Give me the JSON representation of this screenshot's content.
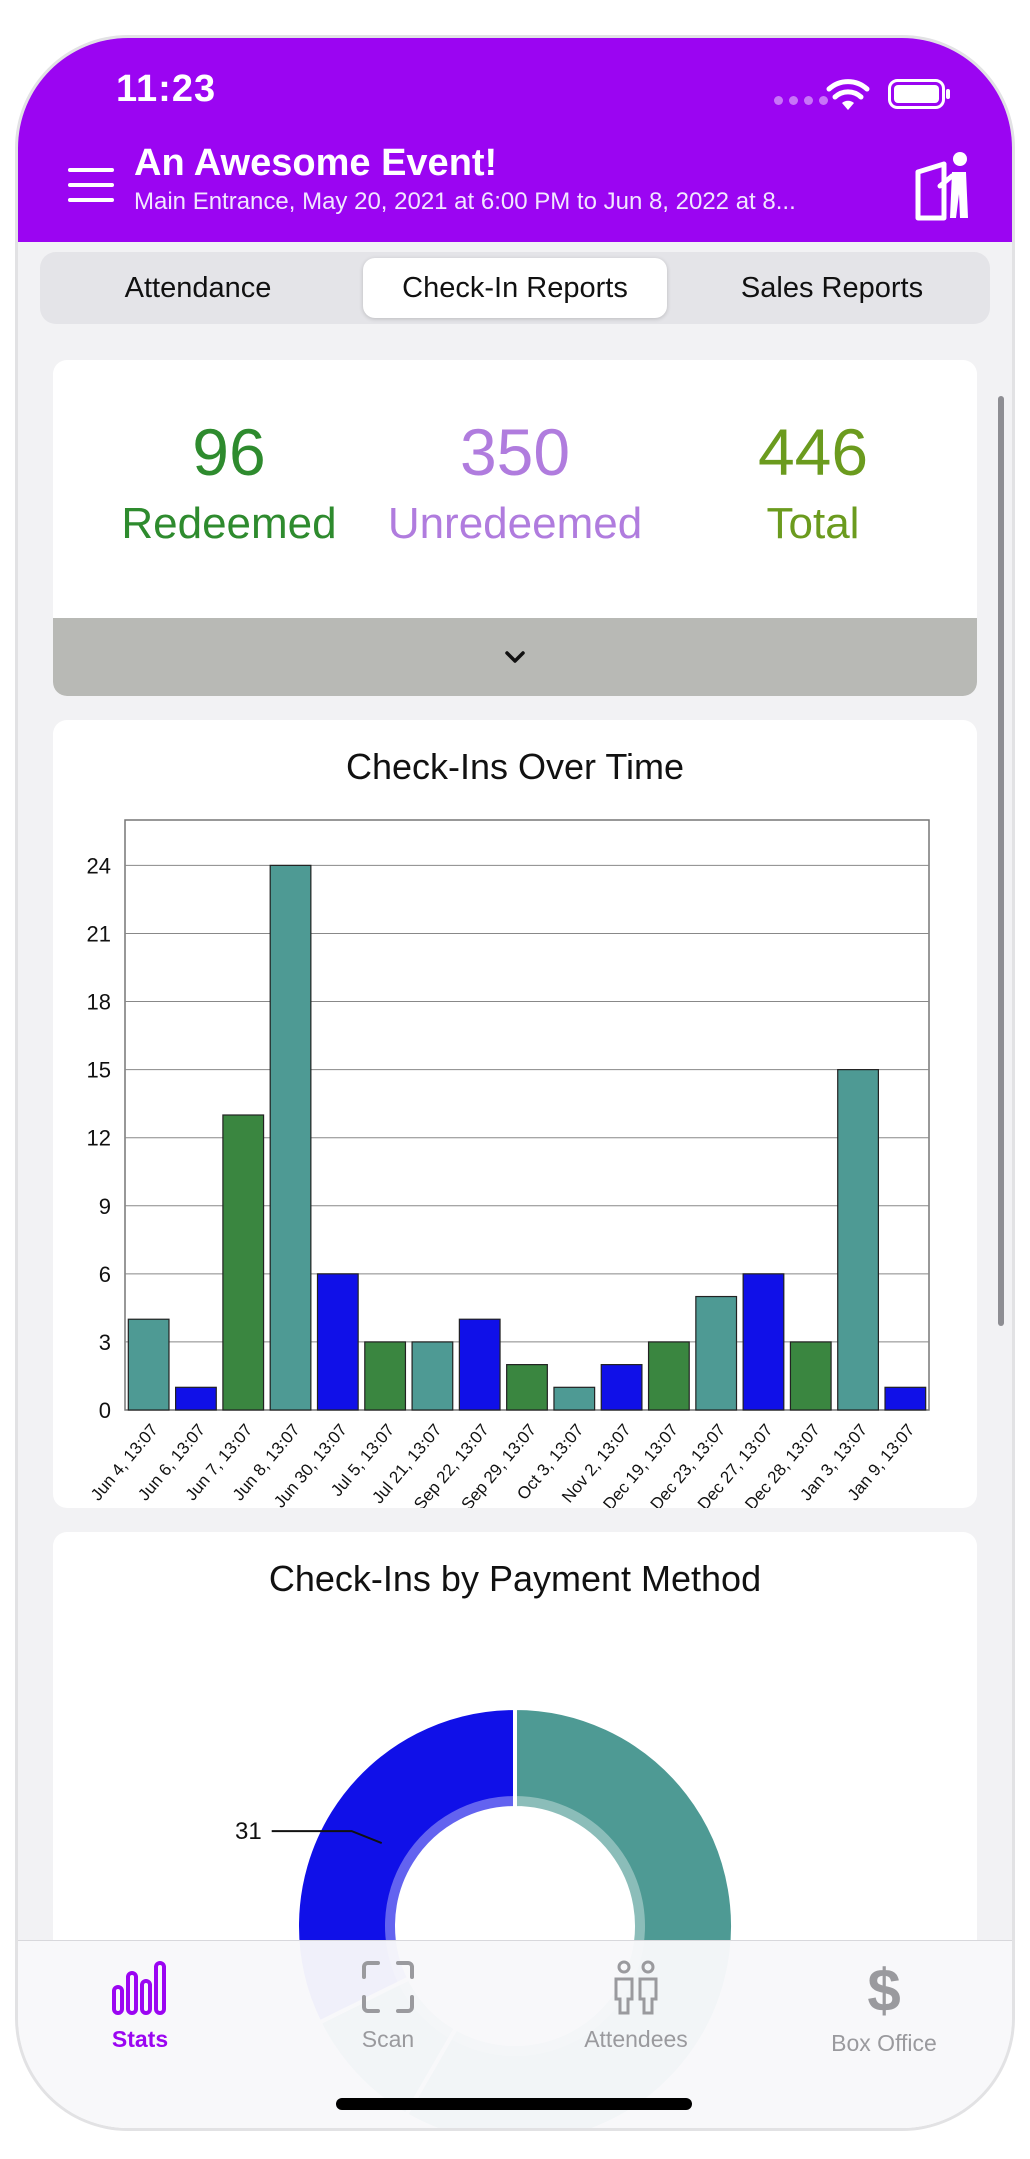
{
  "status_bar": {
    "time": "11:23"
  },
  "header": {
    "title": "An Awesome Event!",
    "subtitle": "Main Entrance, May 20, 2021 at 6:00 PM to Jun  8, 2022 at 8..."
  },
  "tabs": [
    {
      "label": "Attendance",
      "active": false
    },
    {
      "label": "Check-In Reports",
      "active": true
    },
    {
      "label": "Sales Reports",
      "active": false
    }
  ],
  "summary": {
    "redeemed_value": "96",
    "redeemed_label": "Redeemed",
    "redeemed_color": "#2e8b2e",
    "unredeemed_value": "350",
    "unredeemed_label": "Unredeemed",
    "unredeemed_color": "#b07cde",
    "total_value": "446",
    "total_label": "Total",
    "total_color": "#6b9b1e"
  },
  "chart_data": [
    {
      "type": "bar",
      "title": "Check-Ins Over Time",
      "categories": [
        "Jun 4, 13:07",
        "Jun 6, 13:07",
        "Jun 7, 13:07",
        "Jun 8, 13:07",
        "Jun 30, 13:07",
        "Jul 5, 13:07",
        "Jul 21, 13:07",
        "Sep 22, 13:07",
        "Sep 29, 13:07",
        "Oct 3, 13:07",
        "Nov 2, 13:07",
        "Dec 19, 13:07",
        "Dec 23, 13:07",
        "Dec 27, 13:07",
        "Dec 28, 13:07",
        "Jan 3, 13:07",
        "Jan 9, 13:07"
      ],
      "values": [
        4,
        1,
        13,
        24,
        6,
        3,
        3,
        4,
        2,
        1,
        2,
        3,
        5,
        6,
        3,
        15,
        1
      ],
      "bar_colors": [
        "#4e9a94",
        "#1010e8",
        "#3a8640",
        "#4e9a94",
        "#1010e8",
        "#3a8640",
        "#4e9a94",
        "#1010e8",
        "#3a8640",
        "#4e9a94",
        "#1010e8",
        "#3a8640",
        "#4e9a94",
        "#1010e8",
        "#3a8640",
        "#4e9a94",
        "#1010e8"
      ],
      "yticks": [
        0,
        3,
        6,
        9,
        12,
        15,
        18,
        21,
        24
      ],
      "ylim": [
        0,
        26
      ],
      "grid": true
    },
    {
      "type": "pie",
      "title": "Check-Ins by Payment Method",
      "slices": [
        {
          "value": 56,
          "color": "#4e9a94",
          "label": ""
        },
        {
          "value": 9,
          "color": "#4e9a94",
          "label": ""
        },
        {
          "value": 31,
          "color": "#1010e8",
          "label": "31"
        }
      ],
      "donut": true
    }
  ],
  "tabbar": [
    {
      "label": "Stats",
      "icon": "stats-icon",
      "active": true
    },
    {
      "label": "Scan",
      "icon": "scan-icon",
      "active": false
    },
    {
      "label": "Attendees",
      "icon": "attendees-icon",
      "active": false
    },
    {
      "label": "Box Office",
      "icon": "dollar-icon",
      "active": false
    }
  ]
}
